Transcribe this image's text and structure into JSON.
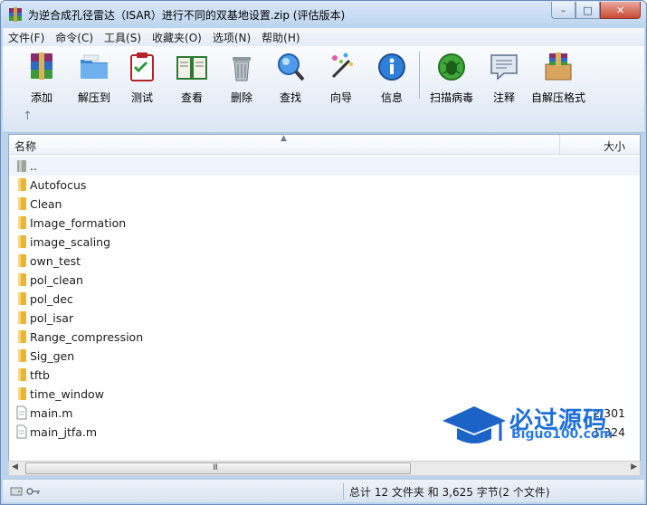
{
  "window": {
    "title": "为逆合成孔径雷达（ISAR）进行不同的双基地设置.zip (评估版本)",
    "controls": {
      "minimize": "–",
      "maximize": "□",
      "close": "✕"
    }
  },
  "menu": [
    {
      "label": "文件(F)"
    },
    {
      "label": "命令(C)"
    },
    {
      "label": "工具(S)"
    },
    {
      "label": "收藏夹(O)"
    },
    {
      "label": "选项(N)"
    },
    {
      "label": "帮助(H)"
    }
  ],
  "toolbar": {
    "buttons": [
      {
        "label": "添加",
        "icon": "add-archive-icon"
      },
      {
        "label": "解压到",
        "icon": "extract-to-icon"
      },
      {
        "label": "测试",
        "icon": "test-icon"
      },
      {
        "label": "查看",
        "icon": "view-icon"
      },
      {
        "label": "删除",
        "icon": "delete-icon"
      },
      {
        "label": "查找",
        "icon": "find-icon"
      },
      {
        "label": "向导",
        "icon": "wizard-icon"
      },
      {
        "label": "信息",
        "icon": "info-icon"
      },
      {
        "label": "扫描病毒",
        "icon": "virus-scan-icon"
      },
      {
        "label": "注释",
        "icon": "comment-icon"
      },
      {
        "label": "自解压格式",
        "icon": "sfx-icon"
      }
    ],
    "up_arrow": "↑"
  },
  "filelist": {
    "columns": {
      "name": "名称",
      "size": "大小"
    },
    "rows": [
      {
        "name": "..",
        "size": "",
        "type": "parent"
      },
      {
        "name": "Autofocus",
        "size": "",
        "type": "folder"
      },
      {
        "name": "Clean",
        "size": "",
        "type": "folder"
      },
      {
        "name": "Image_formation",
        "size": "",
        "type": "folder"
      },
      {
        "name": "image_scaling",
        "size": "",
        "type": "folder"
      },
      {
        "name": "own_test",
        "size": "",
        "type": "folder"
      },
      {
        "name": "pol_clean",
        "size": "",
        "type": "folder"
      },
      {
        "name": "pol_dec",
        "size": "",
        "type": "folder"
      },
      {
        "name": "pol_isar",
        "size": "",
        "type": "folder"
      },
      {
        "name": "Range_compression",
        "size": "",
        "type": "folder"
      },
      {
        "name": "Sig_gen",
        "size": "",
        "type": "folder"
      },
      {
        "name": "tftb",
        "size": "",
        "type": "folder"
      },
      {
        "name": "time_window",
        "size": "",
        "type": "folder"
      },
      {
        "name": "main.m",
        "size": "2,301",
        "type": "file"
      },
      {
        "name": "main_jtfa.m",
        "size": "1,324",
        "type": "file"
      }
    ]
  },
  "scrollbar": {
    "left": "◀",
    "right": "▶",
    "grip": "III"
  },
  "status": {
    "text": "总计 12 文件夹 和 3,625 字节(2 个文件)"
  },
  "watermark": {
    "title": "必过源码",
    "url": "Biguo100.com"
  },
  "colors": {
    "folder": "#e8b53a",
    "accent": "#1e6fd6",
    "close": "#c74a35"
  }
}
